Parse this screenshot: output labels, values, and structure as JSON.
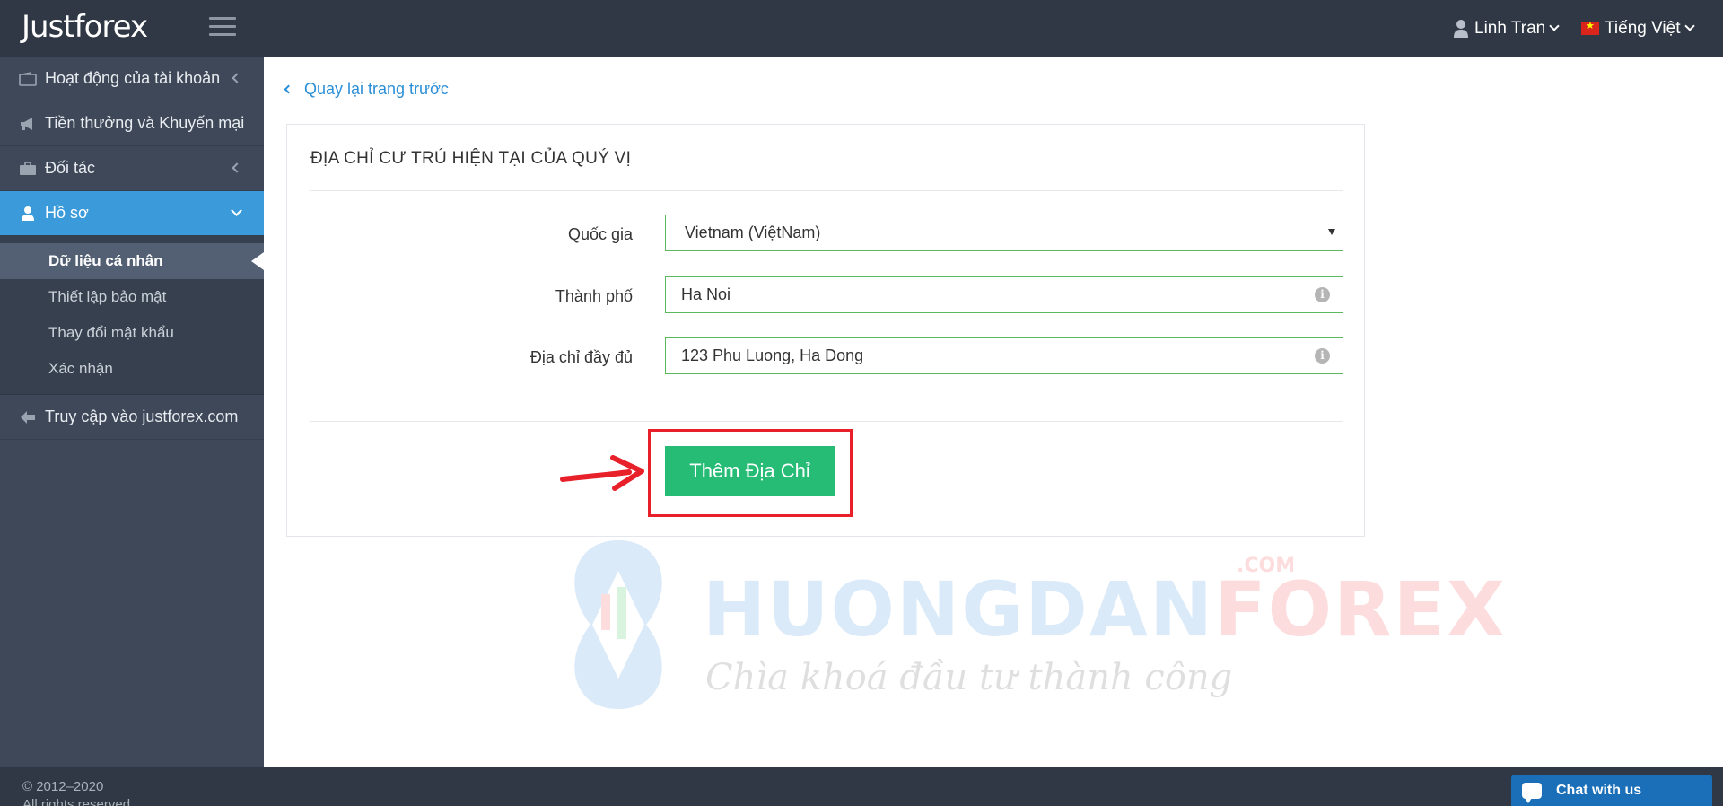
{
  "brand": {
    "logo": "Justforex"
  },
  "header": {
    "user_name": "Linh Tran",
    "language": "Tiếng Việt"
  },
  "sidebar": {
    "items": [
      {
        "label": "Hoạt động của tài khoản",
        "icon": "wallet-icon"
      },
      {
        "label": "Tiền thưởng và Khuyến mại",
        "icon": "megaphone-icon"
      },
      {
        "label": "Đối tác",
        "icon": "briefcase-icon"
      },
      {
        "label": "Hồ sơ",
        "icon": "user-icon"
      }
    ],
    "subitems": [
      {
        "label": "Dữ liệu cá nhân"
      },
      {
        "label": "Thiết lập bảo mật"
      },
      {
        "label": "Thay đổi mật khẩu"
      },
      {
        "label": "Xác nhận"
      }
    ],
    "external": {
      "label": "Truy cập vào justforex.com",
      "icon": "arrow-left-icon"
    }
  },
  "main": {
    "back_link": "Quay lại trang trước",
    "panel_title": "ĐỊA CHỈ CƯ TRÚ HIỆN TẠI CỦA QUÝ VỊ",
    "fields": {
      "country": {
        "label": "Quốc gia",
        "value": "Vietnam (ViệtNam)"
      },
      "city": {
        "label": "Thành phố",
        "value": "Ha Noi"
      },
      "address": {
        "label": "Địa chỉ đầy đủ",
        "value": "123 Phu Luong, Ha Dong"
      }
    },
    "submit_label": "Thêm Địa Chỉ"
  },
  "watermark": {
    "part1": "HUONGDAN",
    "part2": "FOREX",
    "com": ".COM",
    "tagline": "Chìa khoá đầu tư thành công"
  },
  "footer": {
    "copyright_line1": "© 2012–2020",
    "copyright_line2": "All rights reserved",
    "chat_label": "Chat with us"
  },
  "colors": {
    "topbar": "#2f3844",
    "sidebar": "#3e4858",
    "active": "#3b9ad9",
    "link": "#2b8fd6",
    "button": "#26bc76",
    "field_border": "#5cb85c",
    "highlight": "#e8202a"
  }
}
